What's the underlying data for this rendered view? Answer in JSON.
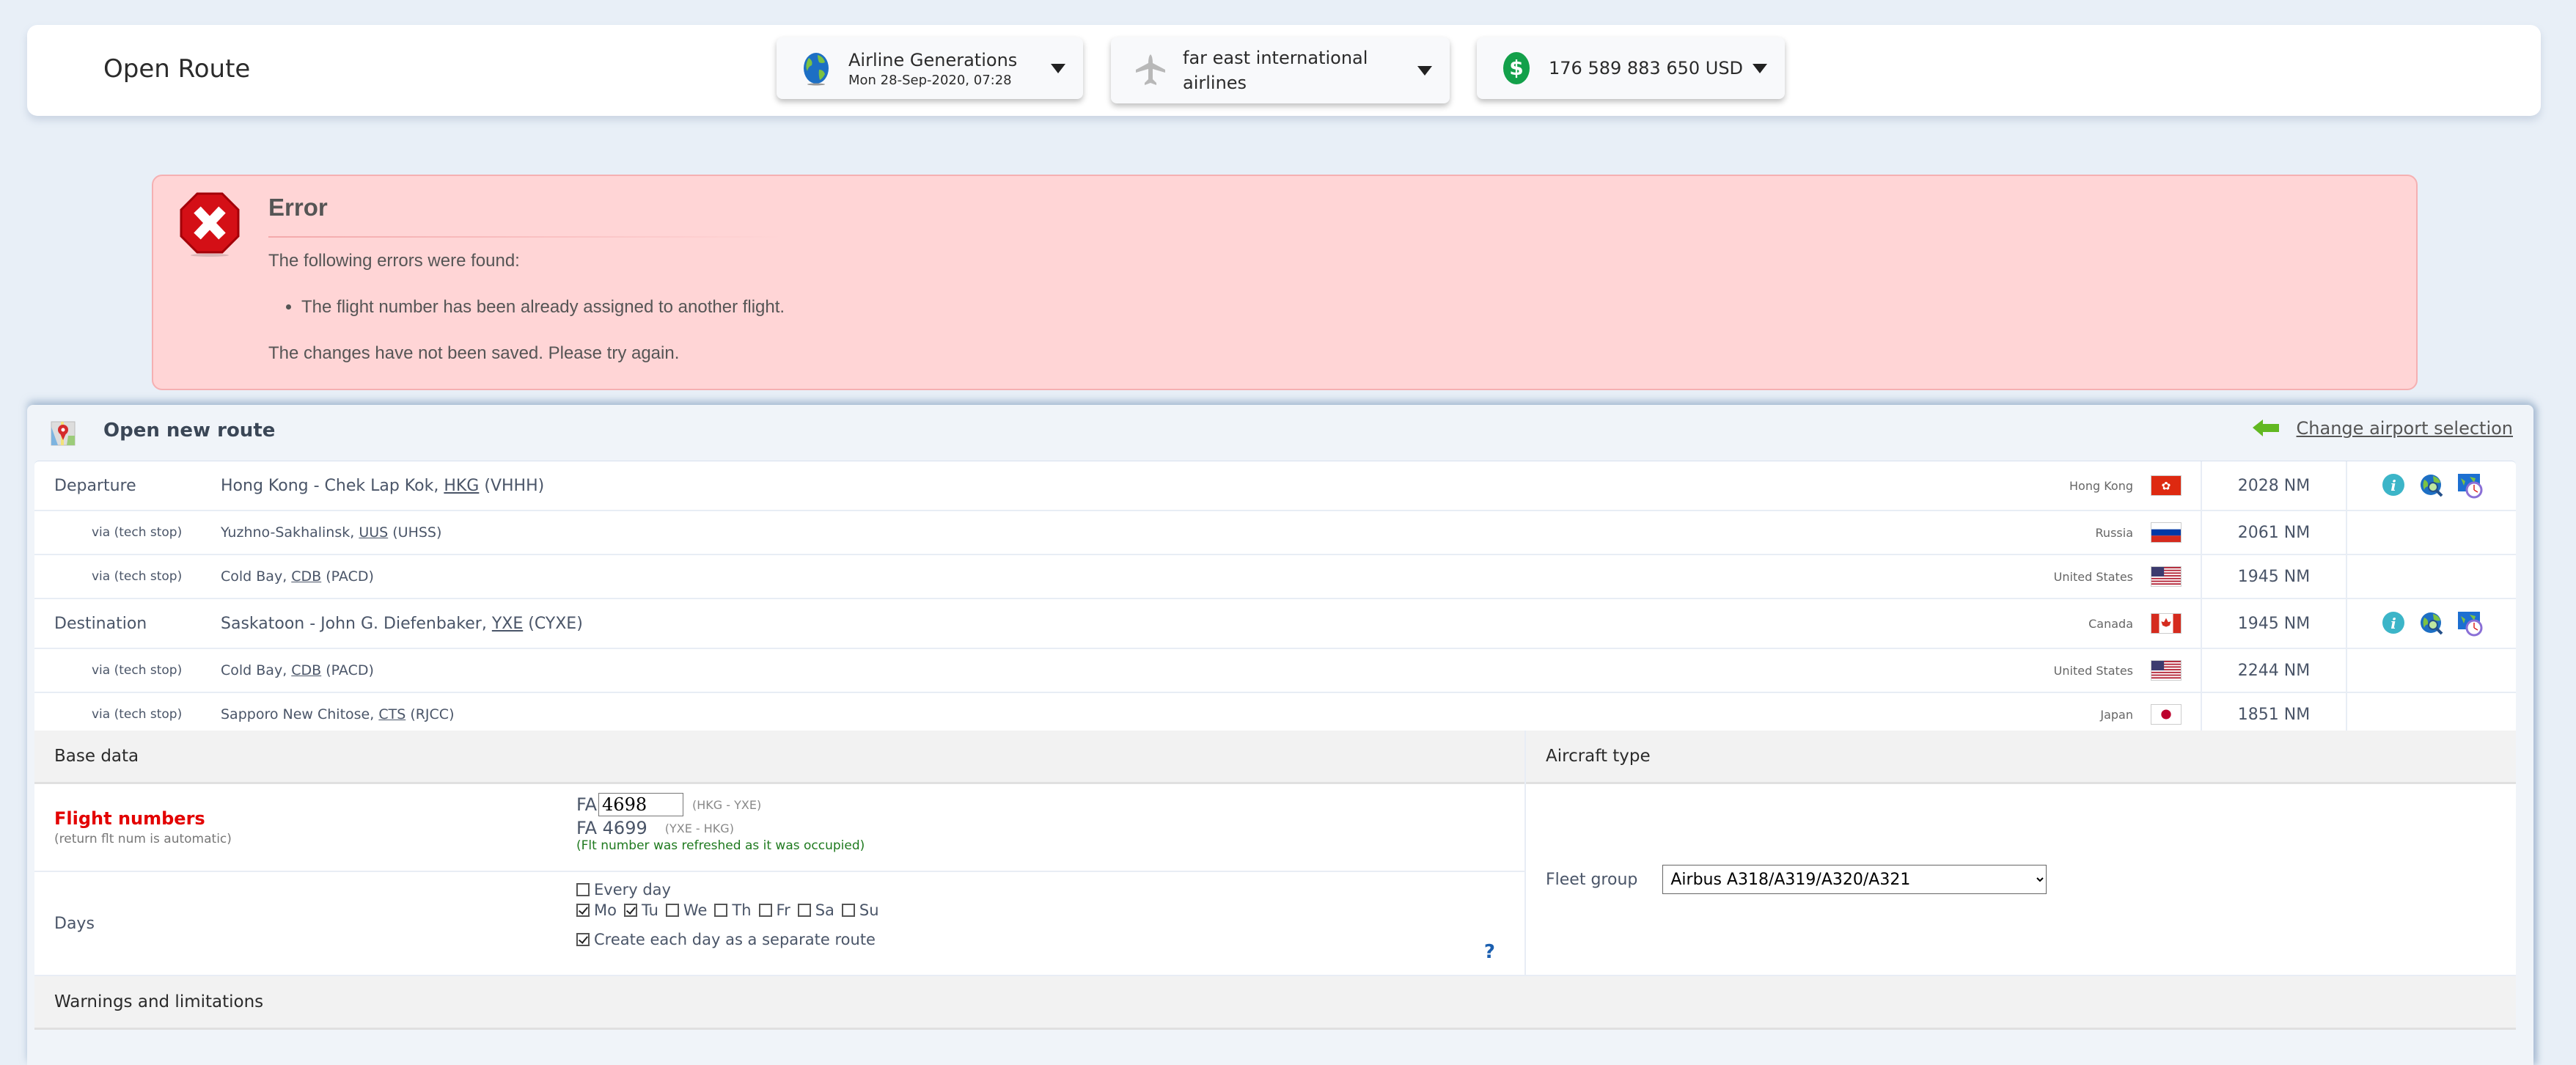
{
  "header": {
    "title": "Open Route",
    "game_pill": {
      "name": "Airline Generations",
      "datetime": "Mon 28-Sep-2020, 07:28",
      "icon": "globe-icon"
    },
    "airline_pill": {
      "name": "far east international airlines",
      "icon": "airplane-icon"
    },
    "balance_pill": {
      "value": "176 589 883 650 USD",
      "icon": "dollar-icon"
    }
  },
  "error": {
    "title": "Error",
    "intro": "The following errors were found:",
    "items": [
      "The flight number has been already assigned to another flight."
    ],
    "footer": "The changes have not been saved. Please try again.",
    "icon": "error-stop-icon"
  },
  "panel": {
    "title": "Open new route",
    "change_link": "Change airport selection",
    "route": [
      {
        "type": "main",
        "label": "Departure",
        "name": "Hong Kong - Chek Lap Kok, ",
        "iata": "HKG",
        "icao": "(VHHH)",
        "country": "Hong Kong",
        "flag": "hk",
        "distance": "2028 NM",
        "actions": true
      },
      {
        "type": "via",
        "label": "via (tech stop)",
        "name": "Yuzhno-Sakhalinsk, ",
        "iata": "UUS",
        "icao": "(UHSS)",
        "country": "Russia",
        "flag": "ru",
        "distance": "2061 NM",
        "actions": false
      },
      {
        "type": "via",
        "label": "via (tech stop)",
        "name": "Cold Bay, ",
        "iata": "CDB",
        "icao": "(PACD)",
        "country": "United States",
        "flag": "us",
        "distance": "1945 NM",
        "actions": false
      },
      {
        "type": "main",
        "label": "Destination",
        "name": "Saskatoon - John G. Diefenbaker, ",
        "iata": "YXE",
        "icao": "(CYXE)",
        "country": "Canada",
        "flag": "ca",
        "distance": "1945 NM",
        "actions": true
      },
      {
        "type": "via",
        "label": "via (tech stop)",
        "name": "Cold Bay, ",
        "iata": "CDB",
        "icao": "(PACD)",
        "country": "United States",
        "flag": "us",
        "distance": "2244 NM",
        "actions": false
      },
      {
        "type": "via",
        "label": "via (tech stop)",
        "name": "Sapporo New Chitose, ",
        "iata": "CTS",
        "icao": "(RJCC)",
        "country": "Japan",
        "flag": "jp",
        "distance": "1851 NM",
        "actions": false
      }
    ]
  },
  "base_data": {
    "heading": "Base data",
    "flight_numbers": {
      "label": "Flight numbers",
      "sublabel": "(return flt num is automatic)",
      "prefix": "FA",
      "outbound_value": "4698",
      "outbound_route": "(HKG - YXE)",
      "return_number": "FA 4699",
      "return_route": "(YXE - HKG)",
      "note": "(Flt number was refreshed as it was occupied)"
    },
    "days": {
      "label": "Days",
      "every_day": {
        "label": "Every day",
        "checked": false
      },
      "weekdays": [
        {
          "label": "Mo",
          "checked": true
        },
        {
          "label": "Tu",
          "checked": true
        },
        {
          "label": "We",
          "checked": false
        },
        {
          "label": "Th",
          "checked": false
        },
        {
          "label": "Fr",
          "checked": false
        },
        {
          "label": "Sa",
          "checked": false
        },
        {
          "label": "Su",
          "checked": false
        }
      ],
      "separate_route": {
        "label": "Create each day as a separate route",
        "checked": true
      },
      "help": "?"
    }
  },
  "aircraft_type": {
    "heading": "Aircraft type",
    "fleet_group_label": "Fleet group",
    "fleet_group_value": "Airbus A318/A319/A320/A321"
  },
  "warnings": {
    "heading": "Warnings and limitations"
  },
  "colors": {
    "background": "#e8eff7",
    "error_bg": "#ffd5d6",
    "error_border": "#f5b0b2",
    "error_label": "#e30000",
    "note_green": "#1f7a1f",
    "section_bg": "#f2f2f2"
  }
}
